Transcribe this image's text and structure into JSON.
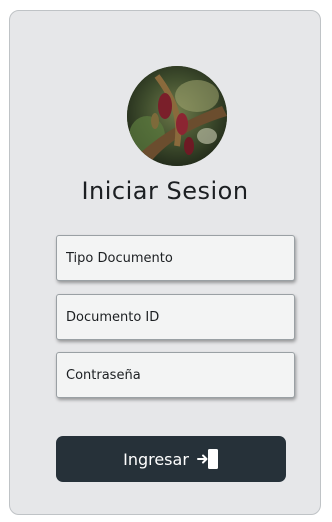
{
  "login": {
    "title": "Iniciar Sesion",
    "fields": [
      {
        "placeholder": "Tipo Documento",
        "value": ""
      },
      {
        "placeholder": "Documento ID",
        "value": ""
      },
      {
        "placeholder": "Contraseña",
        "value": ""
      }
    ],
    "submit_label": "Ingresar",
    "submit_icon": "enter-door-icon"
  },
  "colors": {
    "card_background": "#e6e7e9",
    "button_background": "#263139",
    "button_text": "#ffffff",
    "field_background": "#f3f4f4"
  }
}
